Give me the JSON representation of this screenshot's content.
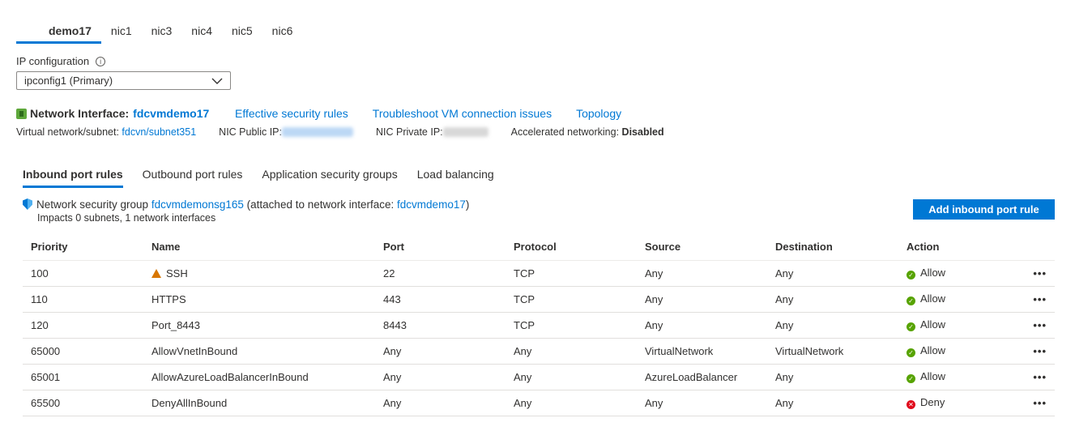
{
  "nic_tabs": [
    "demo17",
    "nic1",
    "nic3",
    "nic4",
    "nic5",
    "nic6"
  ],
  "ip_config": {
    "label": "IP configuration",
    "value": "ipconfig1 (Primary)"
  },
  "nic": {
    "label": "Network Interface:",
    "name": "fdcvmdemo17",
    "links": [
      "Effective security rules",
      "Troubleshoot VM connection issues",
      "Topology"
    ],
    "vnet_label": "Virtual network/subnet:",
    "vnet_value": "fdcvn/subnet351",
    "public_ip_label": "NIC Public IP:",
    "private_ip_label": "NIC Private IP:",
    "accel_label": "Accelerated networking:",
    "accel_value": "Disabled"
  },
  "section_tabs": [
    "Inbound port rules",
    "Outbound port rules",
    "Application security groups",
    "Load balancing"
  ],
  "nsg": {
    "prefix": "Network security group",
    "name": "fdcvmdemonsg165",
    "mid": "(attached to network interface:",
    "nic": "fdcvmdemo17",
    "suffix": ")",
    "impacts": "Impacts 0 subnets, 1 network interfaces"
  },
  "add_button": "Add inbound port rule",
  "columns": [
    "Priority",
    "Name",
    "Port",
    "Protocol",
    "Source",
    "Destination",
    "Action"
  ],
  "rows": [
    [
      "100",
      "SSH",
      "22",
      "TCP",
      "Any",
      "Any",
      "Allow"
    ],
    [
      "110",
      "HTTPS",
      "443",
      "TCP",
      "Any",
      "Any",
      "Allow"
    ],
    [
      "120",
      "Port_8443",
      "8443",
      "TCP",
      "Any",
      "Any",
      "Allow"
    ],
    [
      "65000",
      "AllowVnetInBound",
      "Any",
      "Any",
      "VirtualNetwork",
      "VirtualNetwork",
      "Allow"
    ],
    [
      "65001",
      "AllowAzureLoadBalancerInBound",
      "Any",
      "Any",
      "AzureLoadBalancer",
      "Any",
      "Allow"
    ],
    [
      "65500",
      "DenyAllInBound",
      "Any",
      "Any",
      "Any",
      "Any",
      "Deny"
    ]
  ],
  "warning_rows": [
    0
  ],
  "colors": {
    "accent": "#0078d4",
    "allow": "#57a300",
    "deny": "#e00b1c",
    "warn": "#d87600"
  },
  "more_label": "•••"
}
